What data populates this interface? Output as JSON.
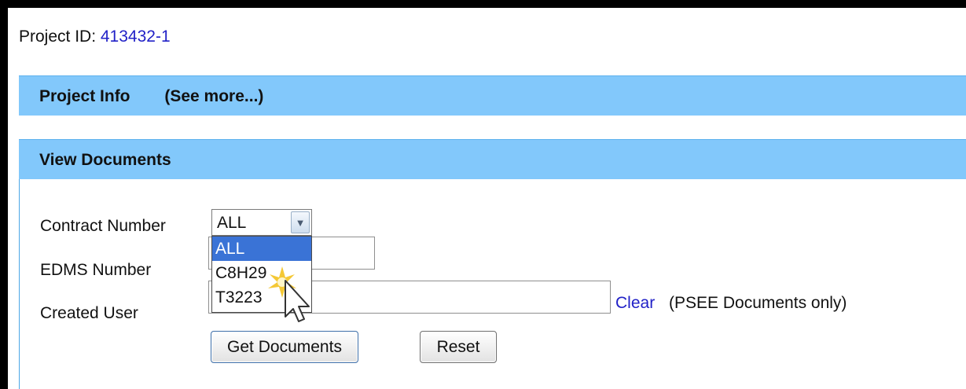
{
  "project": {
    "id_label": "Project ID:",
    "id_value": "413432-1"
  },
  "project_info_bar": {
    "title": "Project Info",
    "see_more": "(See more...)"
  },
  "view_documents_bar": {
    "title": "View Documents"
  },
  "form": {
    "contract_number": {
      "label": "Contract Number",
      "selected_value": "ALL",
      "options": [
        "ALL",
        "C8H29",
        "T3223"
      ],
      "highlighted_index": 0
    },
    "edms_number": {
      "label": "EDMS Number",
      "value": ""
    },
    "created_user": {
      "label": "Created User",
      "value": ""
    },
    "clear_link": "Clear",
    "psee_note": "(PSEE Documents only)",
    "get_documents_button": "Get Documents",
    "reset_button": "Reset"
  },
  "colors": {
    "section_bar": "#82c8fb",
    "link": "#2121c7",
    "dropdown_highlight": "#3a73d6",
    "cursor_spark": "#f3c21f"
  },
  "icons": {
    "cursor": "arrow-cursor-icon",
    "click_spark": "click-spark-icon",
    "dropdown_arrow": "chevron-down-icon"
  }
}
